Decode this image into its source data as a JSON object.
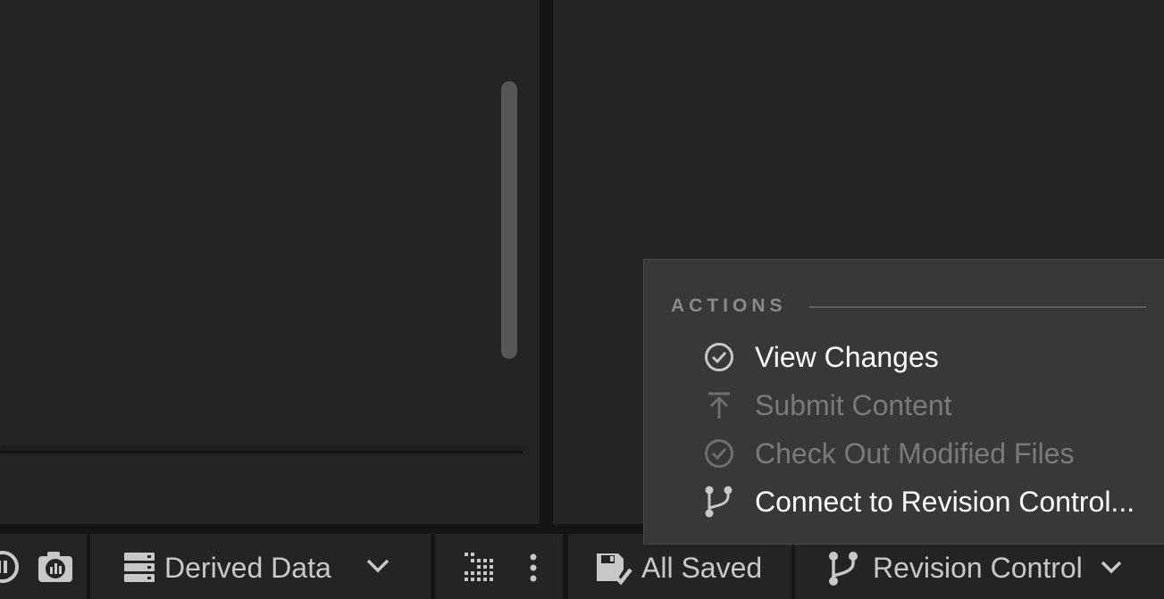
{
  "status_bar": {
    "derived_data_label": "Derived Data",
    "save_status_label": "All Saved",
    "revision_control_label": "Revision Control"
  },
  "revision_menu": {
    "section_header": "ACTIONS",
    "items": [
      {
        "label": "View Changes",
        "icon": "check-circle-icon",
        "enabled": true
      },
      {
        "label": "Submit Content",
        "icon": "upload-arrow-icon",
        "enabled": false
      },
      {
        "label": "Check Out Modified Files",
        "icon": "check-circle-icon",
        "enabled": false
      },
      {
        "label": "Connect to Revision Control...",
        "icon": "branch-icon",
        "enabled": true
      }
    ]
  },
  "colors": {
    "panel": "#242424",
    "background": "#151515",
    "menu": "#383838",
    "text_enabled": "#ffffff",
    "text_disabled": "#7a7a7a"
  }
}
